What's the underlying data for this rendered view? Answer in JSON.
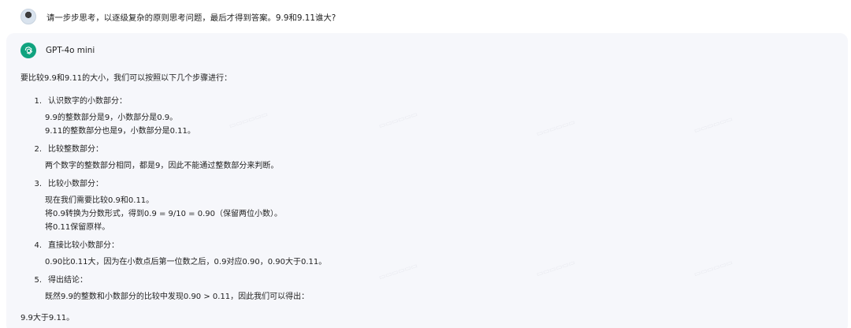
{
  "user": {
    "question": "请一步步思考，以逐级复杂的原则思考问题，最后才得到答案。9.9和9.11谁大?"
  },
  "assistant": {
    "model_name": "GPT-4o mini",
    "intro": "要比较9.9和9.11的大小，我们可以按照以下几个步骤进行：",
    "steps": [
      {
        "num": "1.",
        "title": "认识数字的小数部分：",
        "lines": [
          "9.9的整数部分是9，小数部分是0.9。",
          "9.11的整数部分也是9，小数部分是0.11。"
        ]
      },
      {
        "num": "2.",
        "title": "比较整数部分：",
        "lines": [
          "两个数字的整数部分相同，都是9，因此不能通过整数部分来判断。"
        ]
      },
      {
        "num": "3.",
        "title": "比较小数部分：",
        "lines": [
          "现在我们需要比较0.9和0.11。",
          "将0.9转换为分数形式，得到0.9 = 9/10 = 0.90（保留两位小数）。",
          "将0.11保留原样。"
        ]
      },
      {
        "num": "4.",
        "title": "直接比较小数部分：",
        "lines": [
          "0.90比0.11大，因为在小数点后第一位数之后，0.9对应0.90，0.90大于0.11。"
        ]
      },
      {
        "num": "5.",
        "title": "得出结论：",
        "lines": [
          "既然9.9的整数和小数部分的比较中发现0.90 > 0.11，因此我们可以得出："
        ]
      }
    ],
    "conclusion": "9.9大于9.11。"
  },
  "icons": {
    "avatar": "user-avatar",
    "model": "openai-logo-icon"
  },
  "colors": {
    "card_bg": "#f6f7fb",
    "model_logo": "#10a37f"
  }
}
